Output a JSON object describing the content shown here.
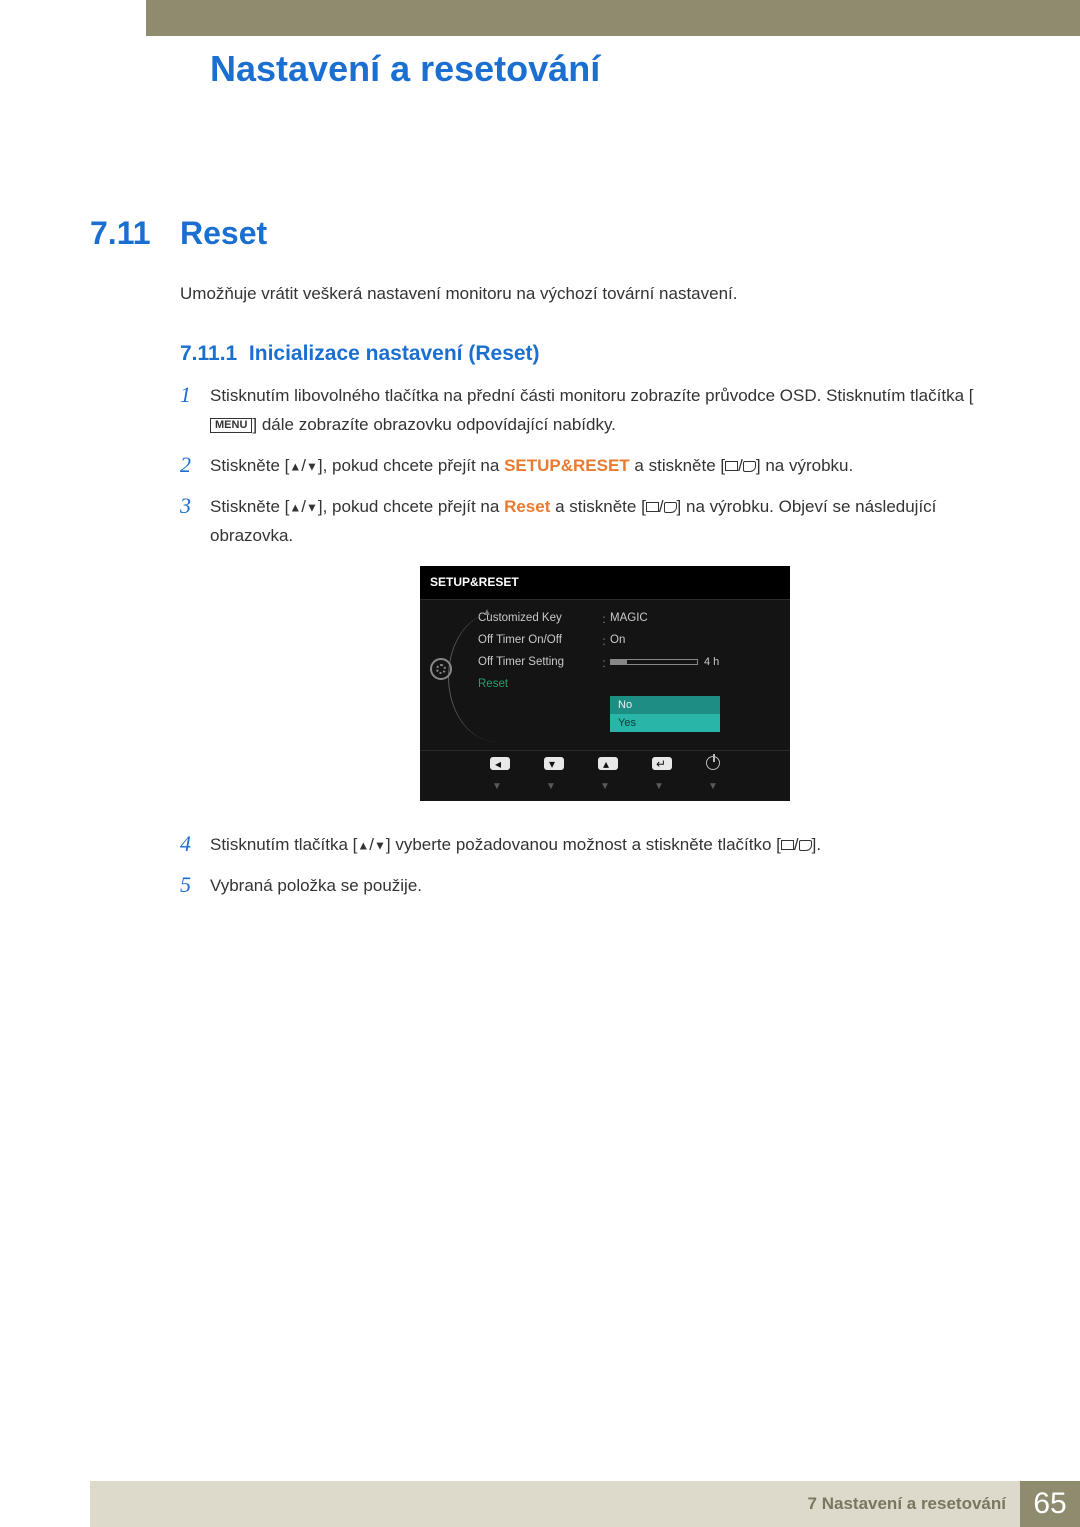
{
  "chapter": {
    "title": "Nastavení a resetování"
  },
  "section": {
    "num": "7.11",
    "title": "Reset"
  },
  "intro": "Umožňuje vrátit veškerá nastavení monitoru na výchozí tovární nastavení.",
  "subsection": {
    "num": "7.11.1",
    "title": "Inicializace nastavení (Reset)"
  },
  "steps": {
    "s1a": "Stisknutím libovolného tlačítka na přední části monitoru zobrazíte průvodce OSD. Stisknutím tlačítka [",
    "s1menu": "MENU",
    "s1b": "] dále zobrazíte obrazovku odpovídající nabídky.",
    "s2a": "Stiskněte [",
    "s2b": "], pokud chcete přejít na ",
    "s2target": "SETUP&RESET",
    "s2c": " a stiskněte [",
    "s2d": "] na výrobku.",
    "s3a": "Stiskněte [",
    "s3b": "], pokud chcete přejít na ",
    "s3target": "Reset",
    "s3c": " a stiskněte [",
    "s3d": "] na výrobku. Objeví se následující obrazovka.",
    "s4a": "Stisknutím tlačítka [",
    "s4b": "] vyberte požadovanou možnost a stiskněte tlačítko [",
    "s4c": "].",
    "s5": "Vybraná položka se použije."
  },
  "osd": {
    "header": "SETUP&RESET",
    "rows": {
      "r1": {
        "label": "Customized Key",
        "value": "MAGIC"
      },
      "r2": {
        "label": "Off Timer On/Off",
        "value": "On"
      },
      "r3": {
        "label": "Off Timer Setting",
        "value": "4 h"
      },
      "r4": {
        "label": "Reset"
      }
    },
    "dropdown": {
      "opt1": "No",
      "opt2": "Yes"
    }
  },
  "footer": {
    "chapter_label": "7 Nastavení a resetování",
    "page": "65"
  }
}
